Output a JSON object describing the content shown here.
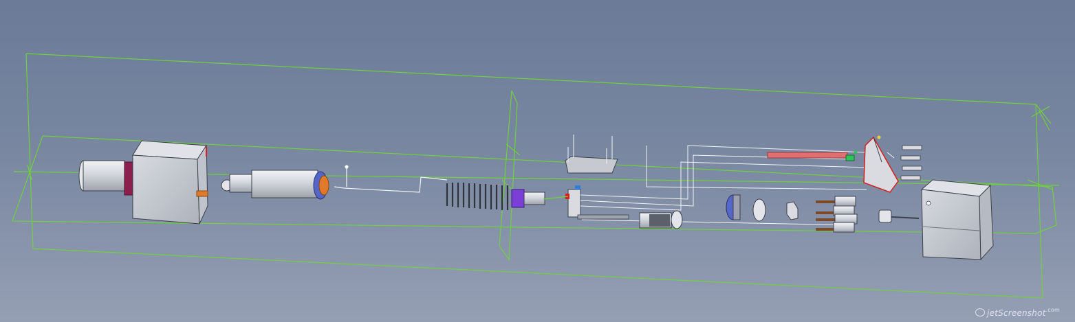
{
  "watermark": {
    "text": "jetScreenshot",
    "suffix": ".com"
  },
  "colors": {
    "background_top": "#6b7b98",
    "background_bottom": "#959fb4",
    "bounding_box": "#6fd23a",
    "wireframe": "#ffffff",
    "part_body": "#c9ccd2",
    "part_edge": "#3a3f4a",
    "spring_accent": "#7a3fd6",
    "flange": "#8d1f4f",
    "heater_rod": "#e07070",
    "bracket_outline": "#d41f1f",
    "cap": "#5566c8"
  },
  "parts": [
    "gearbox-motor",
    "threaded-rod-housing",
    "lead-screw",
    "compression-spring",
    "mounting-plate",
    "bracket",
    "bearing",
    "spacer",
    "nut",
    "contact-pins",
    "heater-rod",
    "screws",
    "triangular-bracket",
    "stepper-motor"
  ]
}
